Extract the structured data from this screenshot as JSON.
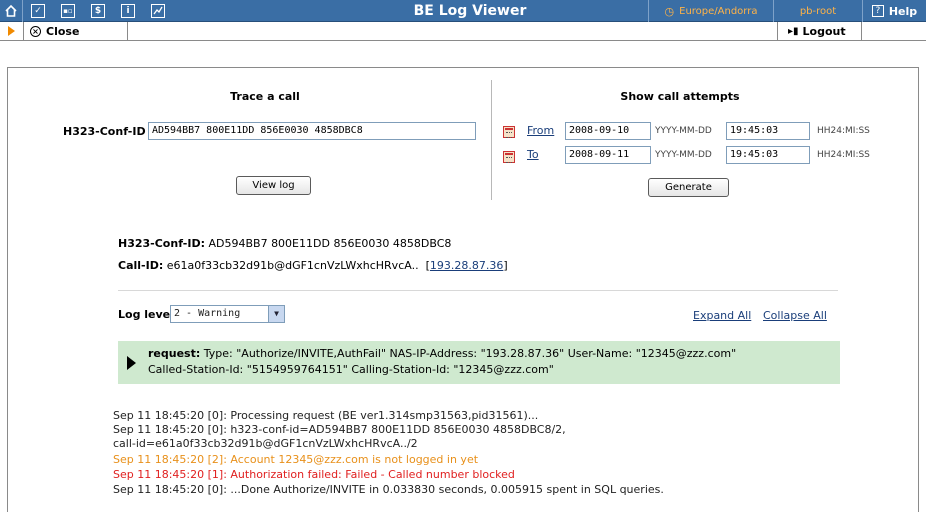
{
  "topbar": {
    "icons": [
      "home-icon",
      "checkbox-icon",
      "grid-icon",
      "dollar-icon",
      "info-icon",
      "chart-icon"
    ],
    "title": "BE Log Viewer",
    "timezone": "Europe/Andorra",
    "user": "pb-root",
    "help": "Help"
  },
  "toolbar": {
    "close_label": "Close",
    "logout_label": "Logout"
  },
  "trace": {
    "title": "Trace a call",
    "conf_label": "H323-Conf-ID",
    "conf_value": "AD594BB7 800E11DD 856E0030 4858DBC8",
    "view_button": "View log"
  },
  "attempts": {
    "title": "Show call attempts",
    "from_label": "From",
    "from_date": "2008-09-10",
    "from_time": "19:45:03",
    "to_label": "To",
    "to_date": "2008-09-11",
    "to_time": "19:45:03",
    "date_format": "YYYY-MM-DD",
    "time_format": "HH24:MI:SS",
    "generate_button": "Generate"
  },
  "call_info": {
    "conf_label": "H323-Conf-ID:",
    "conf_value": "AD594BB7 800E11DD 856E0030 4858DBC8",
    "callid_label": "Call-ID:",
    "callid_value": "e61a0f33cb32d91b@dGF1cnVzLWxhcHRvcA..",
    "ip_open": "[",
    "ip": "193.28.87.36",
    "ip_close": "]"
  },
  "log_controls": {
    "level_label": "Log level:",
    "level_value": "2 - Warning",
    "expand_all": "Expand All",
    "collapse_all": "Collapse All"
  },
  "request": {
    "label": "request:",
    "line1": "Type: \"Authorize/INVITE,AuthFail\"  NAS-IP-Address: \"193.28.87.36\"  User-Name: \"12345@zzz.com\"",
    "line2": "Called-Station-Id: \"5154959764151\"  Calling-Station-Id: \"12345@zzz.com\""
  },
  "log_lines": [
    {
      "text": "Sep 11 18:45:20 [0]: Processing request (BE ver1.314smp31563,pid31561)...",
      "color": "#222222"
    },
    {
      "text": "Sep 11 18:45:20 [0]: h323-conf-id=AD594BB7 800E11DD 856E0030 4858DBC8/2,",
      "color": "#222222"
    },
    {
      "text": "call-id=e61a0f33cb32d91b@dGF1cnVzLWxhcHRvcA../2",
      "color": "#222222"
    },
    {
      "text": "Sep 11 18:45:20 [2]: Account 12345@zzz.com is not logged in yet",
      "color": "#e8901a"
    },
    {
      "text": "Sep 11 18:45:20 [1]: Authorization failed: Failed - Called number blocked",
      "color": "#e02020"
    },
    {
      "text": "Sep 11 18:45:20 [0]: ...Done Authorize/INVITE in 0.033830 seconds, 0.005915 spent in SQL queries.",
      "color": "#222222"
    }
  ],
  "colors": {
    "topbar": "#3a6ea5",
    "accent_orange": "#f08a00",
    "request_bg": "#cfe9cf",
    "link": "#1a3e7a"
  }
}
